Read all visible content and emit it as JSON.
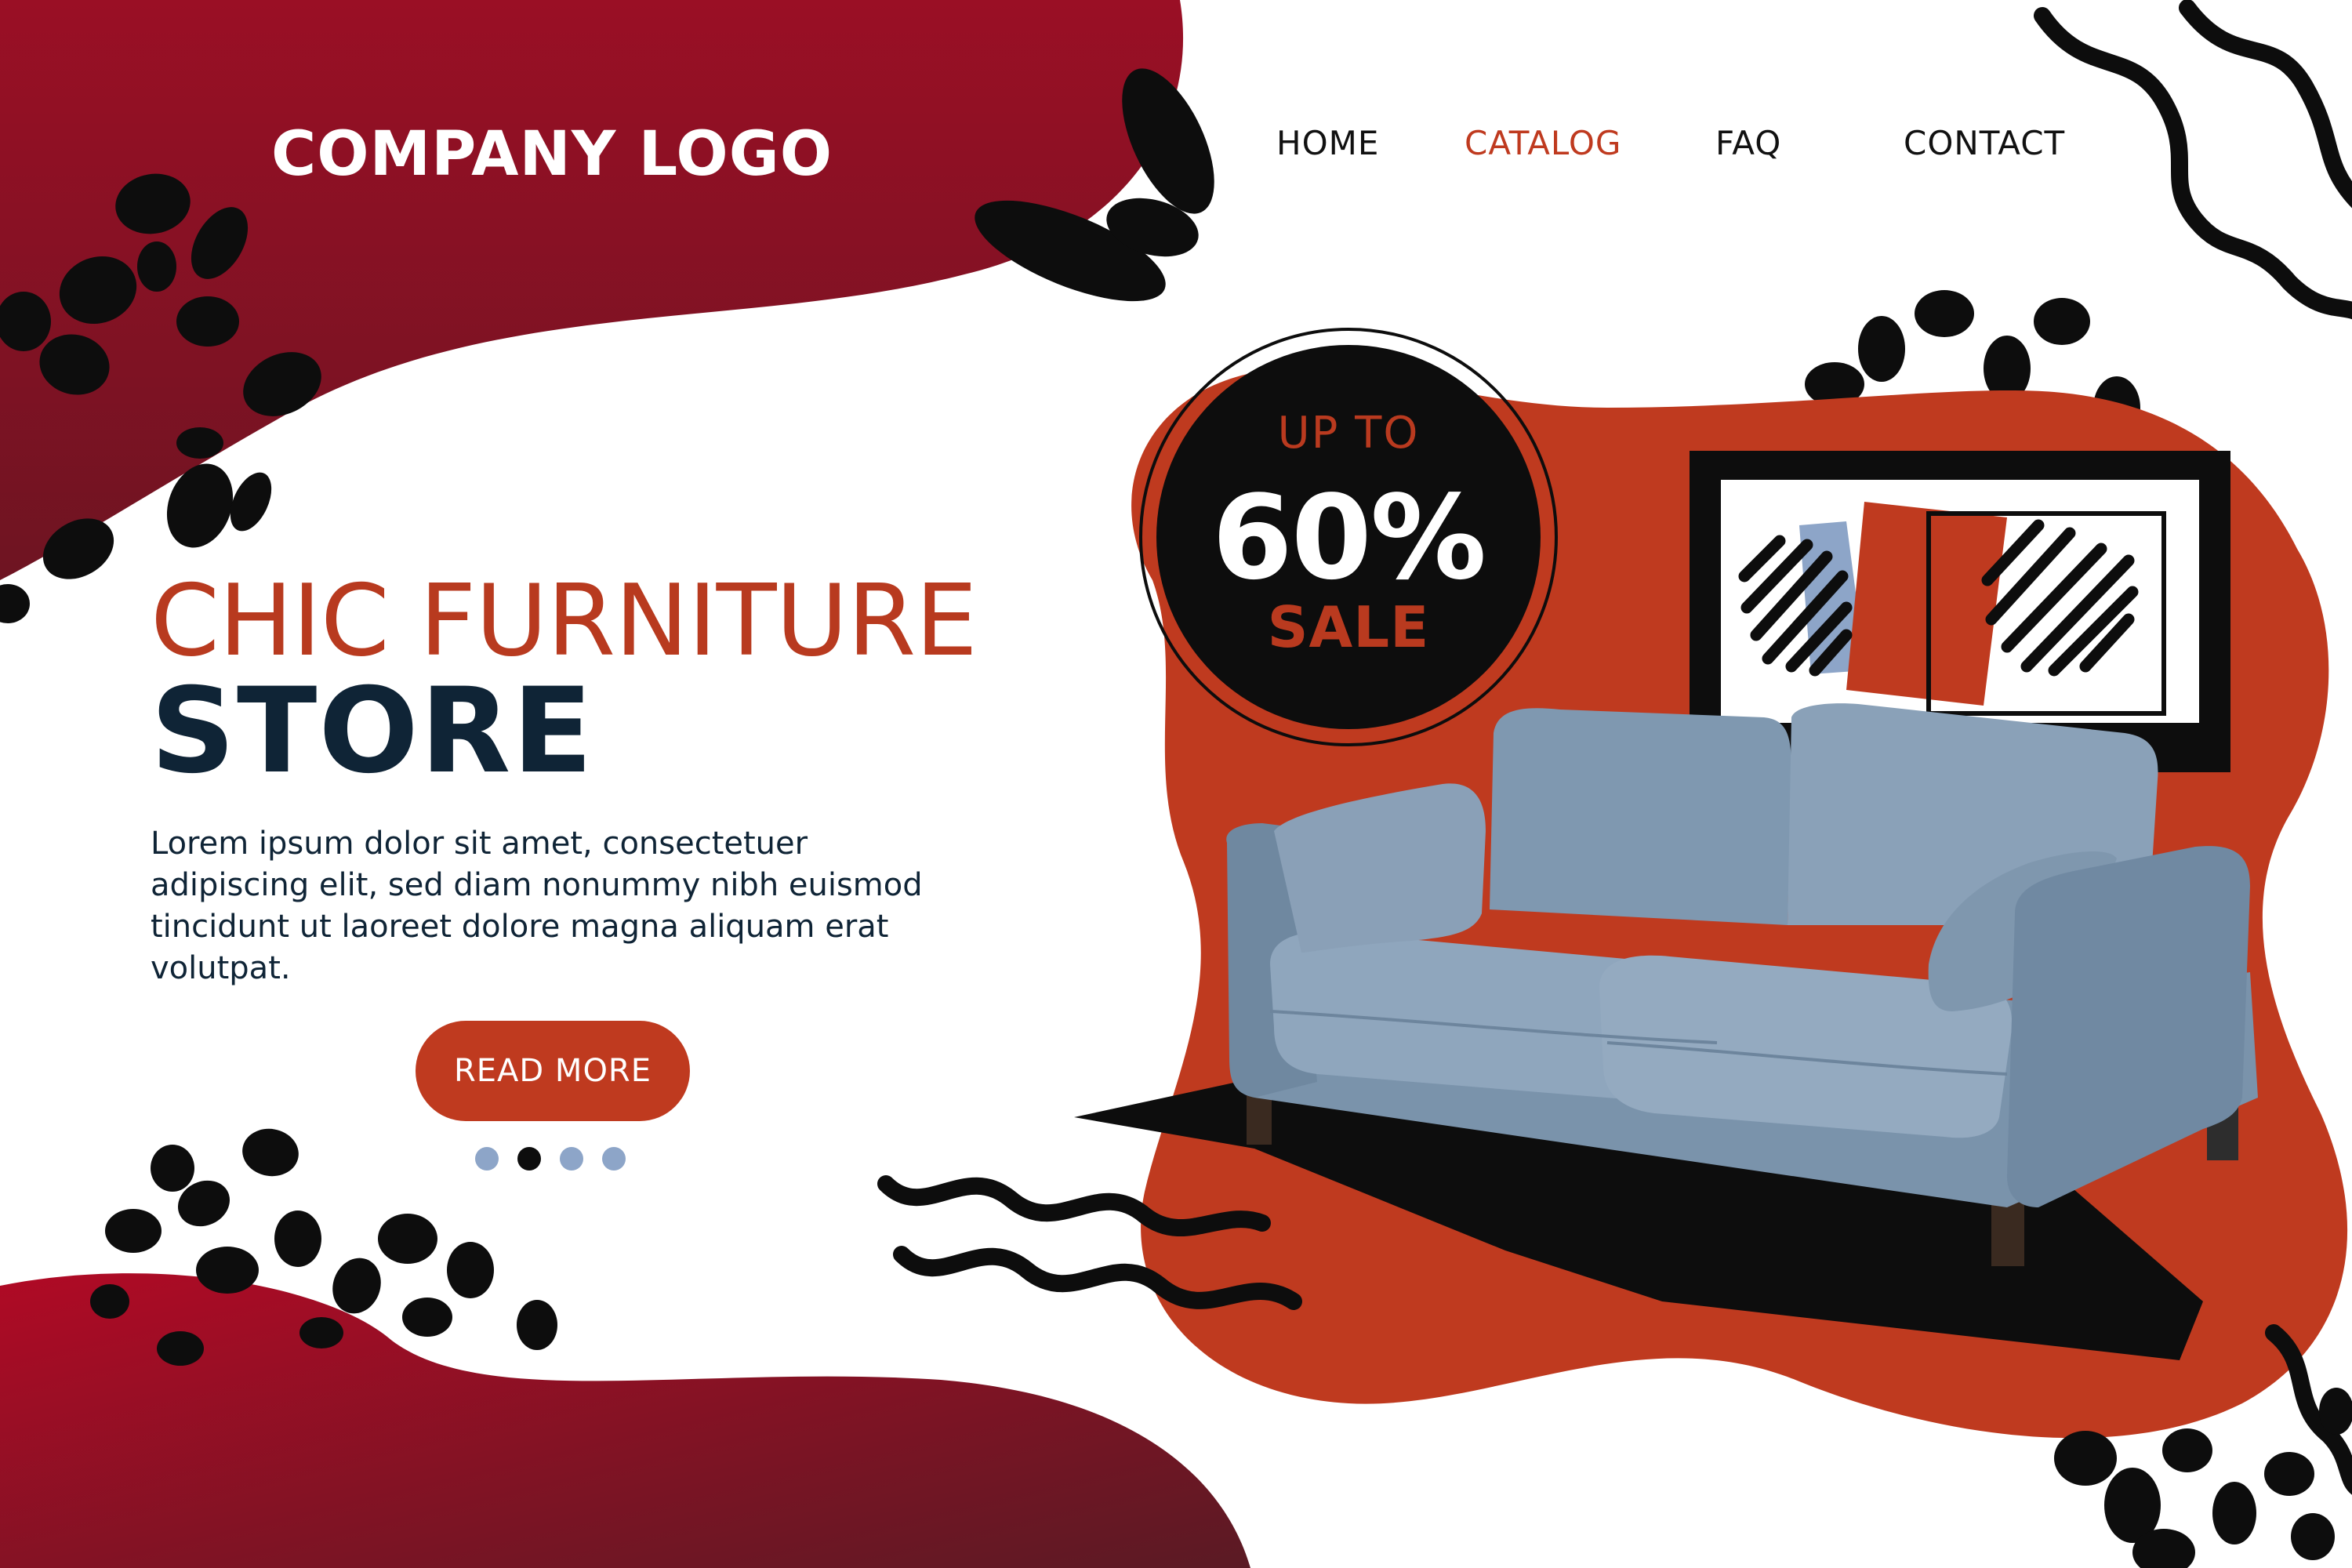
{
  "header": {
    "logo": "COMPANY LOGO",
    "nav": [
      {
        "label": "HOME",
        "active": false
      },
      {
        "label": "CATALOG",
        "active": true
      },
      {
        "label": "FAQ",
        "active": false
      },
      {
        "label": "CONTACT",
        "active": false
      }
    ]
  },
  "hero": {
    "title_light": "CHIC FURNITURE",
    "title_bold": "STORE",
    "body": "Lorem ipsum dolor sit amet, consectetuer adipiscing elit, sed diam nonummy nibh euismod tincidunt ut laoreet dolore magna aliquam erat volutpat.",
    "button_label": "READ MORE",
    "carousel": {
      "count": 4,
      "active_index": 1
    }
  },
  "badge": {
    "line1": "UP TO",
    "percent": "60%",
    "line3": "SALE"
  },
  "colors": {
    "brand_red": "#bf3a1f",
    "dark_red": "#8c1024",
    "navy": "#0f2436",
    "sofa_blue": "#7f98b0",
    "dot_blue": "#8da5c8",
    "black": "#0d0d0d"
  },
  "icons": {
    "product_image": "sofa-illustration",
    "frame": "framed-art-icon"
  }
}
